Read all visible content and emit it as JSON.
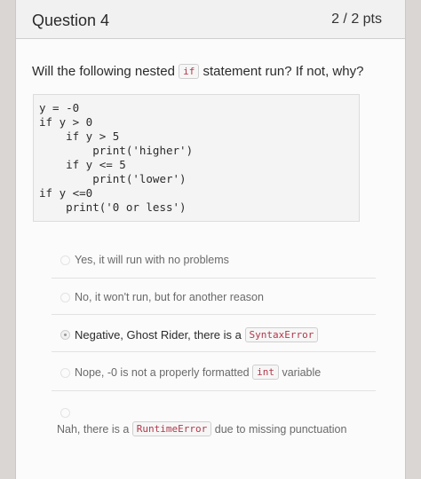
{
  "question": {
    "title": "Question 4",
    "points": "2 / 2 pts",
    "prompt_before": "Will the following nested",
    "prompt_keyword": "if",
    "prompt_after": "statement run? If not, why?"
  },
  "code_lines": [
    "y = -0",
    "if y > 0",
    "    if y > 5",
    "        print('higher')",
    "    if y <= 5",
    "        print('lower')",
    "if y <=0",
    "    print('0 or less')"
  ],
  "options": [
    {
      "text": "Yes, it will run with no problems"
    },
    {
      "text": "No, it won't run, but for another reason"
    },
    {
      "before": "Negative, Ghost Rider, there is a",
      "code": "SyntaxError",
      "after": ""
    },
    {
      "before": "Nope, -0 is not a properly formatted",
      "code": "int",
      "after": "variable"
    },
    {
      "before": "Nah, there is a",
      "code": "RuntimeError",
      "after": "due to missing punctuation"
    }
  ]
}
